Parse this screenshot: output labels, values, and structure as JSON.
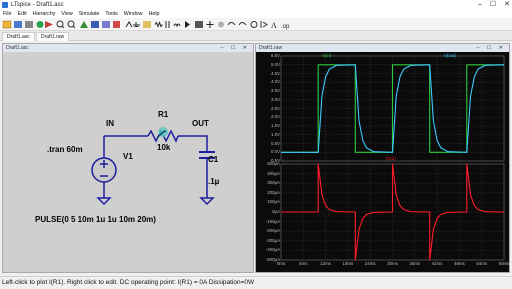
{
  "window": {
    "title": "LTspice - Draft1.asc",
    "controls": [
      "–",
      "☐",
      "✕"
    ]
  },
  "menu": [
    "File",
    "Edit",
    "Hierarchy",
    "View",
    "Simulate",
    "Tools",
    "Window",
    "Help"
  ],
  "tabs": [
    "Draft1.asc",
    "Draft1.raw"
  ],
  "schematic": {
    "title": "Draft1.asc",
    "directive": ".tran 60m",
    "source_name": "V1",
    "source_value": "PULSE(0 5 10m 1u 1u 10m 20m)",
    "resistor_name": "R1",
    "resistor_value": "10k",
    "cap_name": "C1",
    "cap_value": ".1µ",
    "net_in": "IN",
    "net_out": "OUT"
  },
  "waveform": {
    "title": "Draft1.raw",
    "top_legend": [
      "V(in)",
      "V(out)"
    ],
    "bottom_legend": "I(C1)",
    "top_yticks": [
      "5.5V",
      "5.0V",
      "4.5V",
      "4.0V",
      "3.5V",
      "3.0V",
      "2.5V",
      "2.0V",
      "1.5V",
      "1.0V",
      "0.5V",
      "0.0V",
      "-0.5V"
    ],
    "bottom_yticks": [
      "500µA",
      "400µA",
      "300µA",
      "200µA",
      "100µA",
      "0µA",
      "-100µA",
      "-200µA",
      "-300µA",
      "-400µA",
      "-500µA"
    ],
    "xticks": [
      "0ms",
      "6ms",
      "12ms",
      "18ms",
      "24ms",
      "30ms",
      "36ms",
      "42ms",
      "48ms",
      "54ms",
      "60ms"
    ],
    "colors": {
      "vin": "#2ecc40",
      "vout": "#3ec8ff",
      "ic1": "#ff1d2a",
      "grid": "#4a4a4a"
    }
  },
  "chart_data": [
    {
      "type": "line",
      "title": "",
      "xlabel": "",
      "ylabel": "",
      "xlim": [
        0,
        60
      ],
      "ylim": [
        -0.5,
        5.5
      ],
      "series": [
        {
          "name": "V(in)",
          "x": [
            0,
            10,
            10,
            20,
            20,
            30,
            30,
            40,
            40,
            50,
            50,
            60
          ],
          "y": [
            0,
            0,
            5,
            5,
            0,
            0,
            5,
            5,
            0,
            0,
            5,
            5
          ]
        },
        {
          "name": "V(out)",
          "x": [
            0,
            10,
            11,
            12,
            13,
            15,
            20,
            21,
            22,
            23,
            25,
            30,
            31,
            32,
            33,
            35,
            40,
            41,
            42,
            43,
            45,
            50,
            51,
            52,
            53,
            55,
            60
          ],
          "y": [
            0,
            0,
            3.2,
            4.3,
            4.75,
            4.97,
            5,
            1.8,
            0.68,
            0.25,
            0.03,
            0,
            3.2,
            4.3,
            4.75,
            4.97,
            5,
            1.8,
            0.68,
            0.25,
            0.03,
            0,
            3.2,
            4.3,
            4.75,
            4.97,
            5
          ]
        }
      ]
    },
    {
      "type": "line",
      "title": "",
      "xlabel": "",
      "ylabel": "",
      "xlim": [
        0,
        60
      ],
      "ylim": [
        -500,
        500
      ],
      "series": [
        {
          "name": "I(C1)",
          "x": [
            0,
            10,
            10,
            11,
            12,
            13,
            15,
            20,
            20,
            21,
            22,
            23,
            25,
            30,
            30,
            31,
            32,
            33,
            35,
            40,
            40,
            41,
            42,
            43,
            45,
            50,
            50,
            51,
            52,
            53,
            55,
            60
          ],
          "y": [
            0,
            0,
            500,
            180,
            68,
            25,
            3,
            0,
            -500,
            -180,
            -68,
            -25,
            -3,
            0,
            500,
            180,
            68,
            25,
            3,
            0,
            -500,
            -180,
            -68,
            -25,
            -3,
            0,
            500,
            180,
            68,
            25,
            3,
            0
          ]
        }
      ]
    }
  ],
  "status": "Left-click to plot I(R1).  Right click to edit.  DC operating point: I(R1) = 0A   Dissipation=0W"
}
